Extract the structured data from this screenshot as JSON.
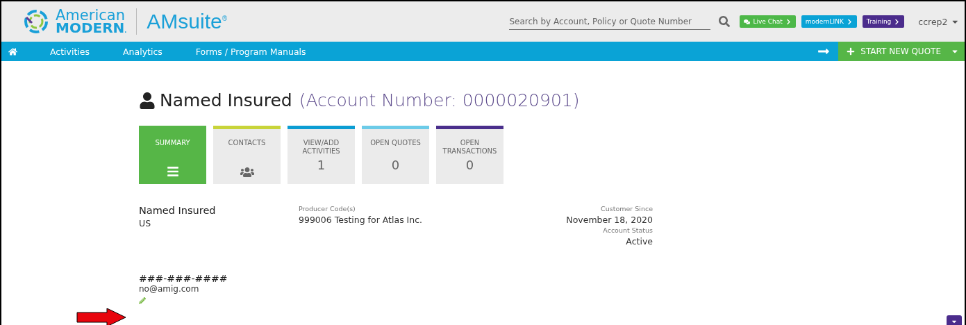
{
  "header": {
    "brand_top": "American",
    "brand_bottom": "MODERN",
    "brand_mark": ".",
    "product": "AMsuite",
    "product_mark": "®",
    "search": {
      "placeholder": "Search by Account, Policy or Quote Number"
    },
    "links": [
      {
        "label": "Live Chat",
        "color": "#4db848",
        "kind": "chat"
      },
      {
        "label": "modernLINK",
        "color": "#0aa3d6",
        "kind": "plain"
      },
      {
        "label": "Training",
        "color": "#4b2c8c",
        "kind": "plain"
      }
    ],
    "user": "ccrep2"
  },
  "nav": {
    "items": [
      "Activities",
      "Analytics",
      "Forms / Program Manuals"
    ],
    "quote_button": "START NEW QUOTE"
  },
  "title": {
    "name": "Named Insured",
    "account": "(Account Number: 0000020901)"
  },
  "tiles": [
    {
      "label": "SUMMARY",
      "kind": "menu",
      "selected": true,
      "color": "#56b647"
    },
    {
      "label": "CONTACTS",
      "kind": "people",
      "selected": false,
      "color": "#c8d43a"
    },
    {
      "label": "VIEW/ADD ACTIVITIES",
      "kind": "count",
      "value": "1",
      "selected": false,
      "color": "#0b9dd3"
    },
    {
      "label": "OPEN QUOTES",
      "kind": "count",
      "value": "0",
      "selected": false,
      "color": "#6ccbe8"
    },
    {
      "label": "OPEN TRANSACTIONS",
      "kind": "count",
      "value": "0",
      "selected": false,
      "color": "#4a2f8c"
    }
  ],
  "insured": {
    "name": "Named Insured",
    "country": "US"
  },
  "producer": {
    "label": "Producer Code(s)",
    "value": "999006 Testing for Atlas Inc."
  },
  "customer": {
    "since_label": "Customer Since",
    "since": "November 18, 2020",
    "status_label": "Account Status",
    "status": "Active"
  },
  "contact": {
    "phone": "###-###-####",
    "email": "no@amig.com"
  }
}
